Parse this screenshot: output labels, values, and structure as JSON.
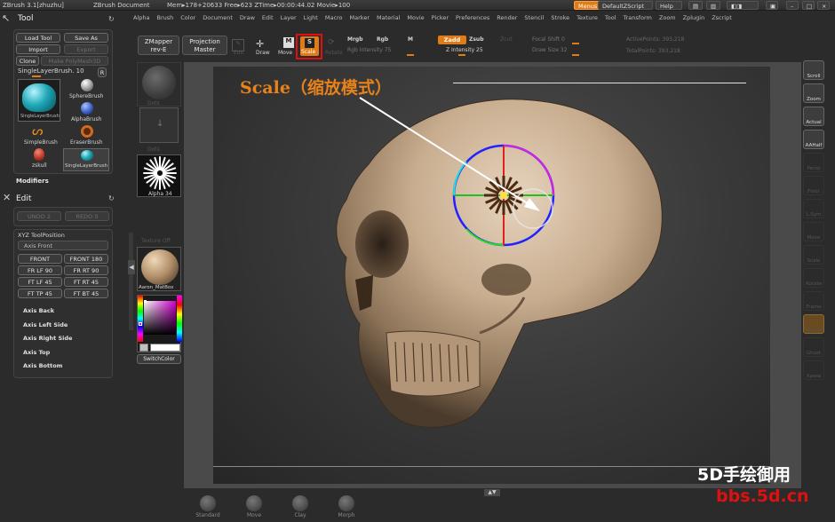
{
  "titlebar": {
    "app": "ZBrush  3.1[zhuzhu]",
    "document": "ZBrush Document",
    "stats": "Mem▸178+20633  Free▸623  ZTime▸00:00:44.02  Movie▸100",
    "menus_btn": "Menus",
    "script_btn": "DefaultZScript",
    "help_btn": "Help"
  },
  "menubar": [
    "Alpha",
    "Brush",
    "Color",
    "Document",
    "Draw",
    "Edit",
    "Layer",
    "Light",
    "Macro",
    "Marker",
    "Material",
    "Movie",
    "Picker",
    "Preferences",
    "Render",
    "Stencil",
    "Stroke",
    "Texture",
    "Tool",
    "Transform",
    "Zoom",
    "Zplugin",
    "Zscript"
  ],
  "tool_panel": {
    "title": "Tool",
    "load_tool": "Load Tool",
    "save_as": "Save As",
    "import": "Import",
    "export": "Export",
    "clone": "Clone",
    "make_polymesh": "Make PolyMesh3D",
    "current_tool": "SingleLayerBrush. 10",
    "r_btn": "R",
    "tools": [
      {
        "label": "SingleLayerBrush",
        "color": "#1fa9b8"
      },
      {
        "label": "SphereBrush",
        "color": "#bcbcbc"
      },
      {
        "label": "AlphaBrush",
        "color": "#3a5fc4"
      },
      {
        "label": "SimpleBrush",
        "color": "#e88b1c"
      },
      {
        "label": "EraserBrush",
        "color": "#d2691e"
      },
      {
        "label": "zskull",
        "color": "#c0392b"
      },
      {
        "label": "SingleLayerBrush",
        "color": "#1fa9b8"
      }
    ],
    "modifiers": "Modifiers"
  },
  "edit_panel": {
    "title": "Edit",
    "undo": "UNDO 2",
    "redo": "REDO 0",
    "xyz_title": "XYZ ToolPosition",
    "axis_front": "Axis Front",
    "views": [
      "FRONT",
      "FRONT 180",
      "FR LF 90",
      "FR RT 90",
      "FT LF 45",
      "FT RT 45",
      "FT TP 45",
      "FT BT 45"
    ],
    "axes": [
      "Axis Back",
      "Axis Left Side",
      "Axis Right Side",
      "Axis Top",
      "Axis Bottom"
    ]
  },
  "left_shelf": {
    "stroke_label": "Dots",
    "alpha_label": "Alpha 34",
    "texture_label": "Texture Off",
    "material_label": "Aaron_MatBox",
    "switch_color": "SwitchColor"
  },
  "top_shelf": {
    "zmapper": "ZMapper",
    "zmapper_sub": "rev-E",
    "projection": "Projection",
    "projection_sub": "Master",
    "edit": "Edit",
    "draw": "Draw",
    "move": "Move",
    "scale": "Scale",
    "rotate": "Rotate",
    "mrgb": "Mrgb",
    "rgb": "Rgb",
    "m": "M",
    "rgb_intensity": "Rgb Intensity 75",
    "zadd": "Zadd",
    "zsub": "Zsub",
    "zcut": "Zcut",
    "z_intensity": "Z Intensity 25",
    "focal_shift": "Focal Shift 0",
    "draw_size": "Draw Size 32",
    "active_points": "ActivePoints: 393,218",
    "total_points": "TotalPoints: 393,218"
  },
  "annotation": {
    "text": "Scale（缩放模式）",
    "color": "#e8821a"
  },
  "right_tray": [
    "Scroll",
    "Zoom",
    "Actual",
    "AAHalf",
    "Persp",
    "Floor",
    "L.Sym",
    "Move",
    "Scale",
    "Rotate",
    "Frame",
    "Transp",
    "Ghost",
    "Xpose"
  ],
  "bottom_shelf": [
    "Standard",
    "Move",
    "Clay",
    "Morph"
  ],
  "watermark": {
    "line1": "5D手绘御用",
    "line2": "bbs.5d.cn"
  }
}
